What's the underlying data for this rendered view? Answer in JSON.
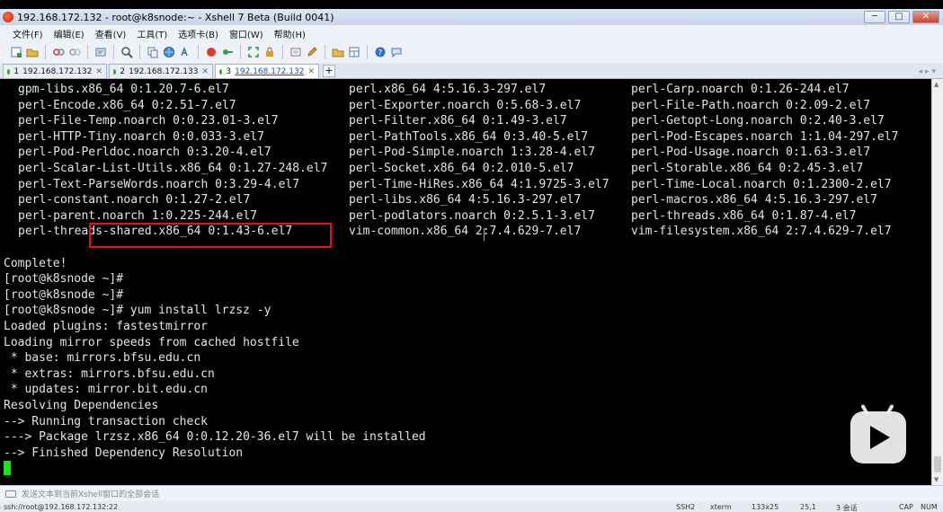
{
  "window": {
    "title": "192.168.172.132 - root@k8snode:~ - Xshell 7 Beta (Build 0041)",
    "controls": {
      "minimize": "─",
      "maximize": "□",
      "close": "✕"
    }
  },
  "menu": [
    "文件(F)",
    "编辑(E)",
    "查看(V)",
    "工具(T)",
    "选项卡(B)",
    "窗口(W)",
    "帮助(H)"
  ],
  "toolbar_icons": [
    "new-session-icon",
    "open-folder-icon",
    "reconnect-icon",
    "disconnect-icon",
    "properties-icon",
    "find-icon",
    "copy-icon",
    "globe-icon",
    "script-icon",
    "record-icon",
    "key-icon",
    "fullscreen-icon",
    "lock-icon",
    "compose-icon",
    "pencil-icon",
    "file-transfer-icon",
    "layout-icon",
    "help-icon",
    "chat-icon"
  ],
  "tabs": [
    {
      "num": "1",
      "label": "192.168.172.132",
      "active": false
    },
    {
      "num": "2",
      "label": "192.168.172.133",
      "active": false
    },
    {
      "num": "3",
      "label": "192.168.172.132",
      "active": true
    }
  ],
  "new_tab": "+",
  "tab_nav": "◂ ▸ ▾",
  "terminal": {
    "package_rows": [
      [
        "gpm-libs.x86_64 0:1.20.7-6.el7",
        "perl.x86_64 4:5.16.3-297.el7",
        "perl-Carp.noarch 0:1.26-244.el7"
      ],
      [
        "perl-Encode.x86_64 0:2.51-7.el7",
        "perl-Exporter.noarch 0:5.68-3.el7",
        "perl-File-Path.noarch 0:2.09-2.el7"
      ],
      [
        "perl-File-Temp.noarch 0:0.23.01-3.el7",
        "perl-Filter.x86_64 0:1.49-3.el7",
        "perl-Getopt-Long.noarch 0:2.40-3.el7"
      ],
      [
        "perl-HTTP-Tiny.noarch 0:0.033-3.el7",
        "perl-PathTools.x86_64 0:3.40-5.el7",
        "perl-Pod-Escapes.noarch 1:1.04-297.el7"
      ],
      [
        "perl-Pod-Perldoc.noarch 0:3.20-4.el7",
        "perl-Pod-Simple.noarch 1:3.28-4.el7",
        "perl-Pod-Usage.noarch 0:1.63-3.el7"
      ],
      [
        "perl-Scalar-List-Utils.x86_64 0:1.27-248.el7",
        "perl-Socket.x86_64 0:2.010-5.el7",
        "perl-Storable.x86_64 0:2.45-3.el7"
      ],
      [
        "perl-Text-ParseWords.noarch 0:3.29-4.el7",
        "perl-Time-HiRes.x86_64 4:1.9725-3.el7",
        "perl-Time-Local.noarch 0:1.2300-2.el7"
      ],
      [
        "perl-constant.noarch 0:1.27-2.el7",
        "perl-libs.x86_64 4:5.16.3-297.el7",
        "perl-macros.x86_64 4:5.16.3-297.el7"
      ],
      [
        "perl-parent.noarch 1:0.225-244.el7",
        "perl-podlators.noarch 0:2.5.1-3.el7",
        "perl-threads.x86_64 0:1.87-4.el7"
      ],
      [
        "perl-threads-shared.x86_64 0:1.43-6.el7",
        "vim-common.x86_64 2:7.4.629-7.el7",
        "vim-filesystem.x86_64 2:7.4.629-7.el7"
      ]
    ],
    "lines": [
      "",
      "Complete!",
      "[root@k8snode ~]#",
      "[root@k8snode ~]#",
      "[root@k8snode ~]# yum install lrzsz -y",
      "Loaded plugins: fastestmirror",
      "Loading mirror speeds from cached hostfile",
      " * base: mirrors.bfsu.edu.cn",
      " * extras: mirrors.bfsu.edu.cn",
      " * updates: mirror.bit.edu.cn",
      "Resolving Dependencies",
      "--> Running transaction check",
      "---> Package lrzsz.x86_64 0:0.12.20-36.el7 will be installed",
      "--> Finished Dependency Resolution"
    ]
  },
  "input_bar": {
    "placeholder": "发送文本到当前Xshell窗口的全部会话"
  },
  "status": {
    "connection": "ssh://root@192.168.172.132:22",
    "protocol": "SSH2",
    "terminal_type": "xterm",
    "size": "133x25",
    "cursor_pos": "25,1",
    "sessions": "3 会话",
    "caps": "CAP",
    "num": "NUM"
  },
  "colors": {
    "prompt_highlight": "#e11111",
    "cursor": "#1fe01f"
  }
}
